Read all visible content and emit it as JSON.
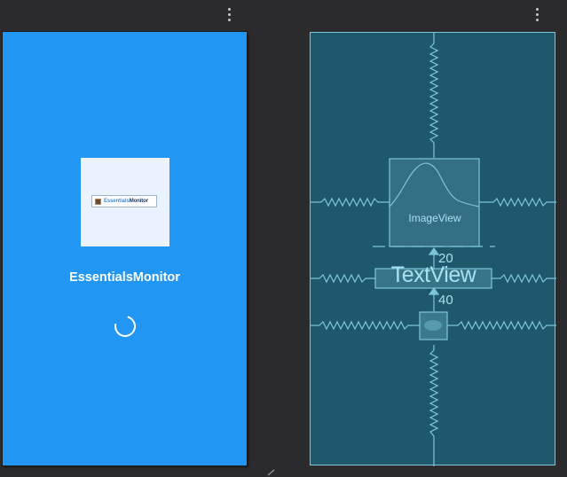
{
  "design": {
    "app_name": "EssentialsMonitor",
    "logo": {
      "text_part1": "Essentials",
      "text_part2": "Monitor"
    },
    "colors": {
      "background": "#2196f3",
      "image_bg": "#eaf3fd",
      "text": "#ffffff"
    }
  },
  "blueprint": {
    "image_view_label": "ImageView",
    "text_view_label": "TextView",
    "margin_top_text": "20",
    "margin_top_progress": "40",
    "colors": {
      "background": "#20586b",
      "lines": "#7cc6da"
    }
  },
  "toolbar": {
    "menu_icon": "more-vert-icon"
  }
}
